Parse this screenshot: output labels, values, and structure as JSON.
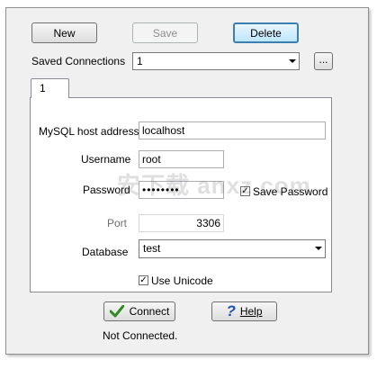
{
  "toolbar": {
    "new_label": "New",
    "save_label": "Save",
    "delete_label": "Delete"
  },
  "saved_connections": {
    "label": "Saved Connections",
    "selected": "1",
    "browse_label": "..."
  },
  "tab": {
    "label": "1"
  },
  "form": {
    "host_label": "MySQL host address",
    "host_value": "localhost",
    "username_label": "Username",
    "username_value": "root",
    "password_label": "Password",
    "password_value": "••••••••",
    "save_password_label": "Save Password",
    "save_password_checked": "✓",
    "port_label": "Port",
    "port_value": "3306",
    "database_label": "Database",
    "database_value": "test",
    "use_unicode_label": "Use Unicode",
    "use_unicode_checked": "✓"
  },
  "footer": {
    "connect_label": "Connect",
    "help_label": "Help",
    "status": "Not Connected."
  },
  "colors": {
    "connect_icon": "#2e8b1f",
    "help_icon": "#1f4fb8",
    "focus_border": "#3c7fb1"
  },
  "watermark": "安下载 anxz.com"
}
